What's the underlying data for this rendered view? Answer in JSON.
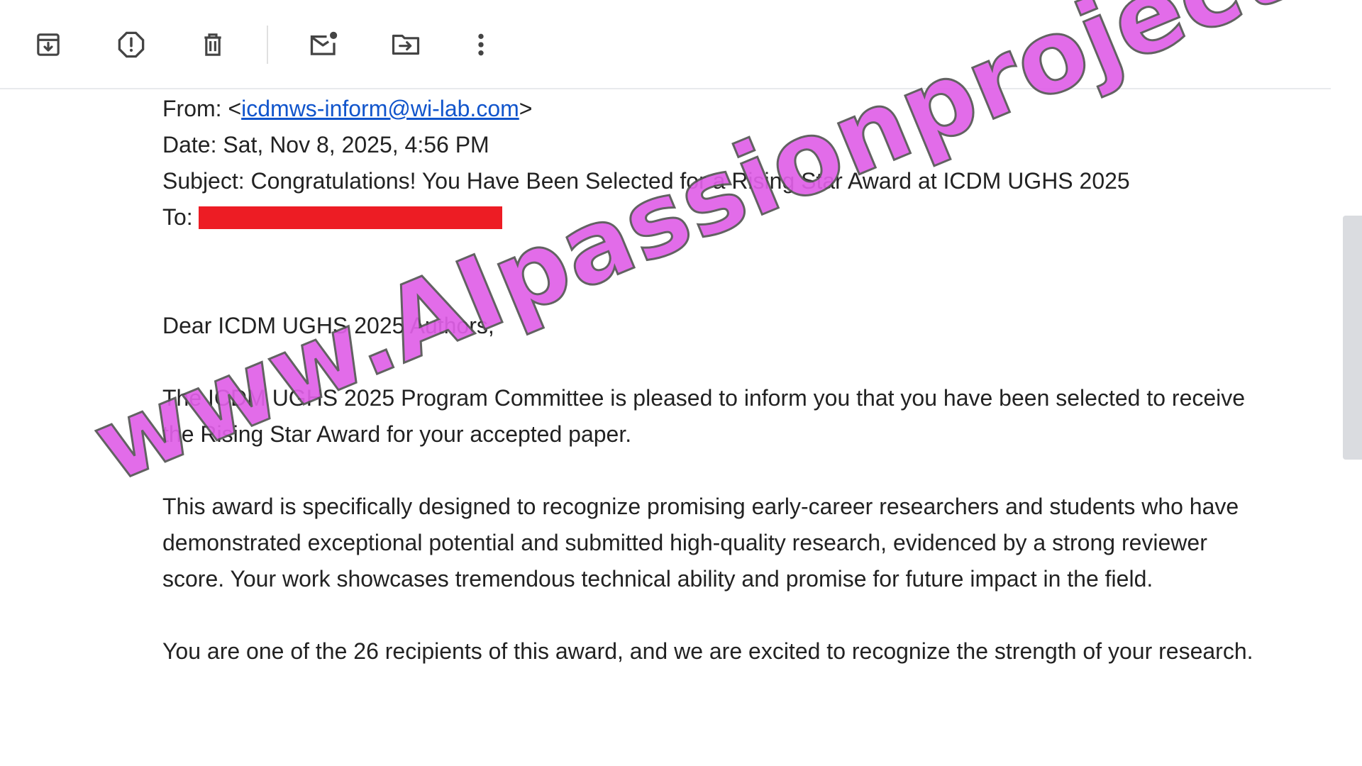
{
  "toolbar": {
    "buttons": [
      {
        "icon": "archive-icon",
        "label": "Archive"
      },
      {
        "icon": "report-spam-icon",
        "label": "Report spam"
      },
      {
        "icon": "delete-icon",
        "label": "Delete"
      },
      {
        "icon": "mark-unread-icon",
        "label": "Mark as unread"
      },
      {
        "icon": "move-to-icon",
        "label": "Move to"
      },
      {
        "icon": "more-options-icon",
        "label": "More"
      }
    ]
  },
  "email": {
    "from_prefix": "From: <",
    "from_address": "icdmws-inform@wi-lab.com",
    "from_suffix": ">",
    "date": "Date: Sat, Nov 8, 2025, 4:56 PM",
    "subject": "Subject: Congratulations! You Have Been Selected for a Rising Star Award at ICDM UGHS 2025",
    "to_label": "To:",
    "greeting": "Dear ICDM UGHS 2025 Authors,",
    "paragraph_1": "The ICDM UGHS 2025 Program Committee is pleased to inform you that you have been selected to receive the Rising Star Award for your accepted paper.",
    "paragraph_2": "This award is specifically designed to recognize promising early-career researchers and students who have demonstrated exceptional potential and submitted high-quality research, evidenced by a strong reviewer score. Your work showcases tremendous technical ability and promise for future impact in the field.",
    "paragraph_3": "You are one of the 26 recipients of this award, and we are excited to recognize the strength of your research."
  },
  "watermark": {
    "text": "www.AIpassionproject.com",
    "color": "#e060e8"
  },
  "colors": {
    "link": "#1155cc",
    "redaction": "#ed1c24"
  }
}
